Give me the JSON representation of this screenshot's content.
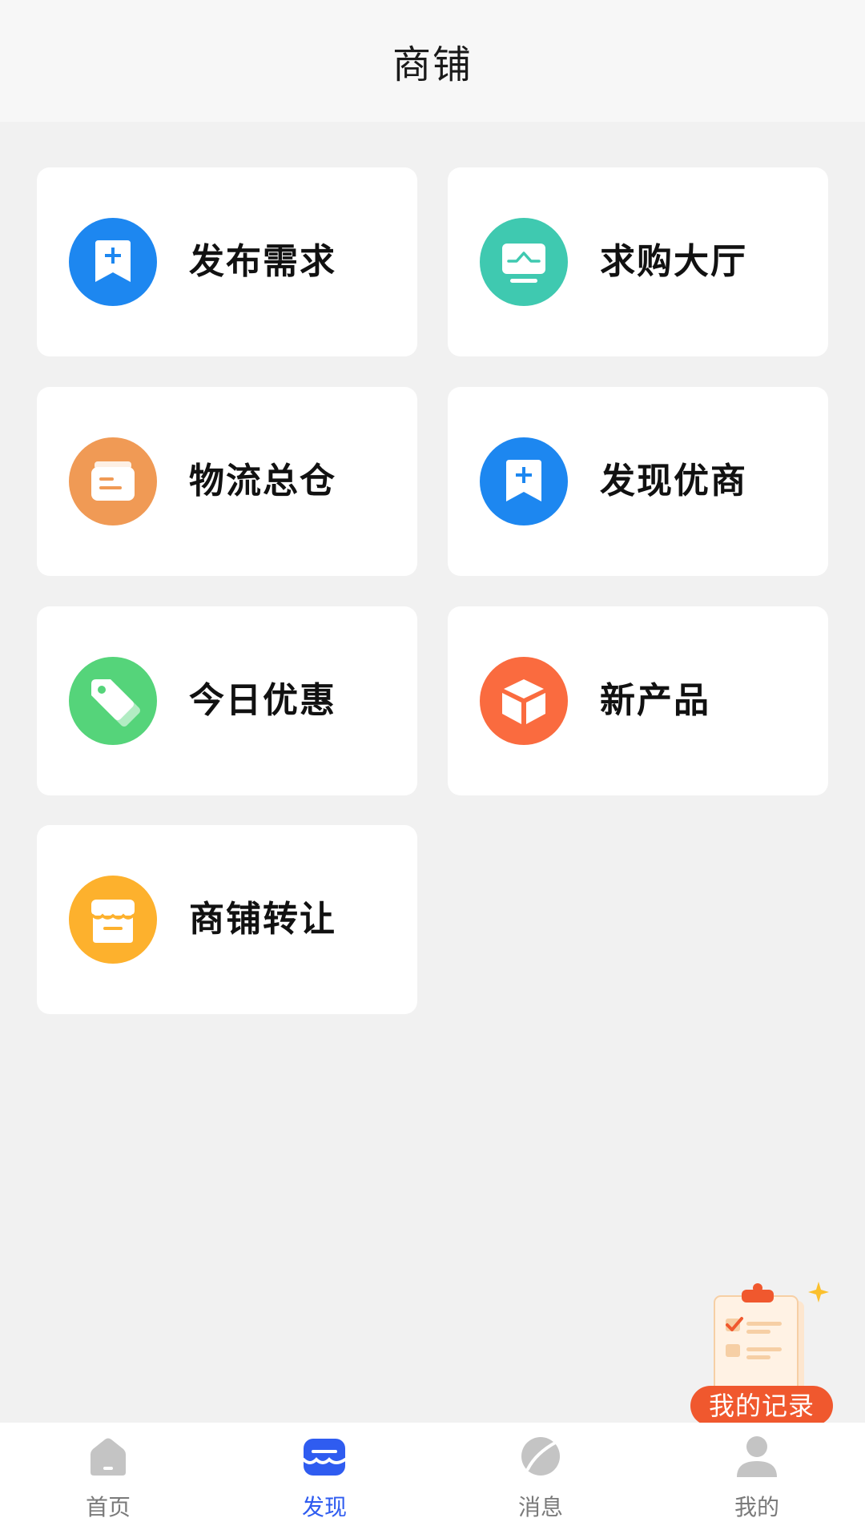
{
  "header": {
    "title": "商铺"
  },
  "cards": [
    {
      "label": "发布需求",
      "icon": "bookmark-plus-icon",
      "color": "#1d87f0"
    },
    {
      "label": "求购大厅",
      "icon": "monitor-chart-icon",
      "color": "#3fc9b0"
    },
    {
      "label": "物流总仓",
      "icon": "warehouse-box-icon",
      "color": "#f09a55"
    },
    {
      "label": "发现优商",
      "icon": "bookmark-plus-icon",
      "color": "#1d87f0"
    },
    {
      "label": "今日优惠",
      "icon": "tag-icon",
      "color": "#55d47a"
    },
    {
      "label": "新产品",
      "icon": "cube-icon",
      "color": "#fa6b3f"
    },
    {
      "label": "商铺转让",
      "icon": "storefront-icon",
      "color": "#fdb12d"
    }
  ],
  "fab": {
    "label": "我的记录",
    "icon": "clipboard-checklist-icon",
    "color": "#f0582e"
  },
  "bottom_nav": {
    "active_index": 1,
    "active_color": "#2f5cf0",
    "inactive_color": "#c4c4c4",
    "items": [
      {
        "label": "首页",
        "icon": "home-icon"
      },
      {
        "label": "发现",
        "icon": "discover-store-icon"
      },
      {
        "label": "消息",
        "icon": "message-leaf-icon"
      },
      {
        "label": "我的",
        "icon": "user-icon"
      }
    ]
  }
}
